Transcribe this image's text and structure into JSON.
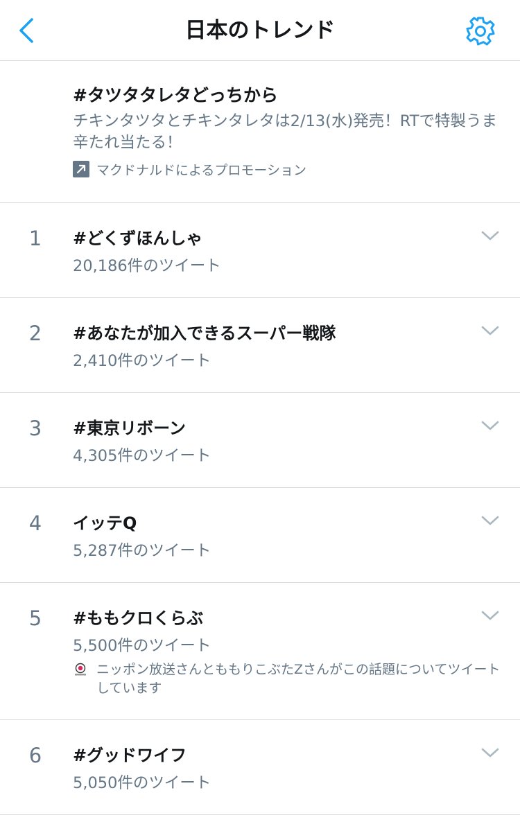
{
  "header": {
    "title": "日本のトレンド",
    "back_icon": "chevron-left-icon",
    "settings_icon": "gear-icon"
  },
  "promoted": {
    "title": "#タツタタレタどっちから",
    "description": "チキンタツタとチキンタレタは2/13(水)発売！RTで特製うま辛たれ当たる！",
    "label": "マクドナルドによるプロモーション",
    "icon": "promoted-arrow-icon"
  },
  "trends": [
    {
      "rank": "1",
      "name": "#どくずほんしゃ",
      "count": "20,186件のツイート"
    },
    {
      "rank": "2",
      "name": "#あなたが加入できるスーパー戦隊",
      "count": "2,410件のツイート"
    },
    {
      "rank": "3",
      "name": "#東京リボーン",
      "count": "4,305件のツイート"
    },
    {
      "rank": "4",
      "name": "イッテQ",
      "count": "5,287件のツイート"
    },
    {
      "rank": "5",
      "name": "#ももクロくらぶ",
      "count": "5,500件のツイート",
      "context": "ニッポン放送さんとももりこぶたZさんがこの話題についてツイートしています"
    },
    {
      "rank": "6",
      "name": "#グッドワイフ",
      "count": "5,050件のツイート"
    }
  ],
  "colors": {
    "accent": "#1da1f2",
    "secondary_text": "#657786",
    "divider": "#d6dadd"
  }
}
